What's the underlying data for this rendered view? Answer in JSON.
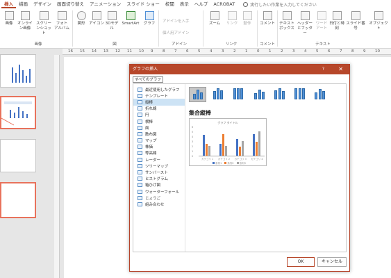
{
  "ribbon": {
    "tabs": [
      "挿入",
      "描画",
      "デザイン",
      "画面切り替え",
      "アニメーション",
      "スライド ショー",
      "校閲",
      "表示",
      "ヘルプ",
      "ACROBAT"
    ],
    "search_placeholder": "実行したい作業を入力してください",
    "groups": {
      "images": "画像",
      "figures": "図",
      "addins": "アドイン",
      "links": "リンク",
      "comments": "コメント",
      "text": "テキスト"
    },
    "buttons": {
      "picture": "画像",
      "online_picture": "オンライン画像",
      "screenshot": "スクリーンショット",
      "photo_album": "フォトアルバム",
      "shapes": "図形",
      "icons": "アイコン",
      "models_3d": "3Dモデル",
      "smartart": "SmartArt",
      "graph": "グラフ",
      "get_addins": "アドインを入手",
      "my_addins": "個人用アドイン",
      "zoom": "ズーム",
      "link": "リンク",
      "action": "動作",
      "comment": "コメント",
      "textbox": "テキストボックス",
      "header_footer": "ヘッダーとフッター",
      "wordart": "ワードアート",
      "datetime": "日付と時刻",
      "slide_number": "スライド番号",
      "object": "オブジェクト"
    }
  },
  "ruler_ticks": [
    "16",
    "15",
    "14",
    "13",
    "12",
    "11",
    "10",
    "9",
    "8",
    "7",
    "6",
    "5",
    "4",
    "3",
    "2",
    "1",
    "0",
    "1",
    "2",
    "3",
    "4",
    "5",
    "6",
    "7",
    "8",
    "9",
    "10"
  ],
  "dialog": {
    "title": "グラフの挿入",
    "help": "?",
    "close": "✕",
    "all_charts_tab": "すべてのグラフ",
    "types": [
      "最近使用したグラフ",
      "テンプレート",
      "縦棒",
      "折れ線",
      "円",
      "横棒",
      "面",
      "散布図",
      "マップ",
      "株価",
      "等高線",
      "レーダー",
      "ツリーマップ",
      "サンバースト",
      "ヒストグラム",
      "箱ひげ図",
      "ウォーターフォール",
      "じょうご",
      "組み合わせ"
    ],
    "selected_type": "縦棒",
    "subtype_title": "集合縦棒",
    "preview": {
      "title": "グラフ タイトル",
      "categories": [
        "カテゴリ 1",
        "カテゴリ 2",
        "カテゴリ 3",
        "カテゴリ 4"
      ],
      "legend": [
        "系列1",
        "系列2",
        "系列3"
      ]
    },
    "ok": "OK",
    "cancel": "キャンセル"
  },
  "chart_data": {
    "type": "bar",
    "title": "グラフ タイトル",
    "categories": [
      "カテゴリ 1",
      "カテゴリ 2",
      "カテゴリ 3",
      "カテゴリ 4"
    ],
    "series": [
      {
        "name": "系列1",
        "values": [
          4.3,
          2.5,
          3.5,
          4.5
        ]
      },
      {
        "name": "系列2",
        "values": [
          2.4,
          4.4,
          1.8,
          2.8
        ]
      },
      {
        "name": "系列3",
        "values": [
          2,
          2,
          3,
          5
        ]
      }
    ],
    "ylim": [
      0,
      6
    ],
    "colors": [
      "#4472c4",
      "#ed7d31",
      "#a5a5a5"
    ],
    "legend": "bottom"
  }
}
